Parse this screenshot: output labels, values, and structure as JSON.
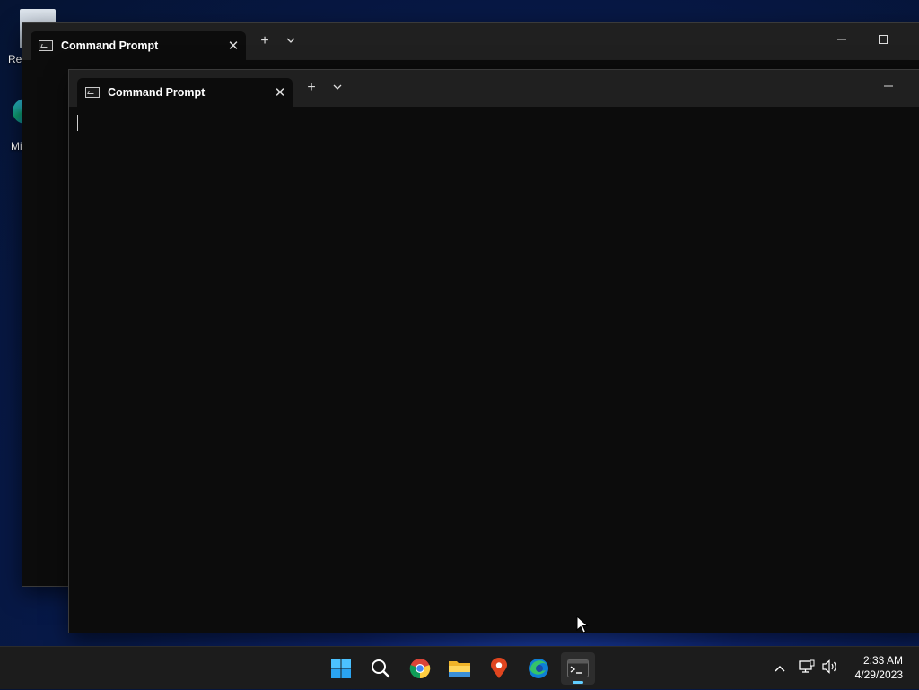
{
  "desktop": {
    "icons": [
      {
        "label": "Rec",
        "icon": "recycle-bin-icon"
      },
      {
        "label": "Mi",
        "icon": "edge-shortcut-icon"
      }
    ]
  },
  "windows": [
    {
      "app": "Windows Terminal",
      "tab_title": "Command Prompt",
      "tab_icon": "cmd-icon",
      "new_tab": "+",
      "close": "✕"
    },
    {
      "app": "Windows Terminal",
      "tab_title": "Command Prompt",
      "tab_icon": "cmd-icon",
      "new_tab": "+",
      "close": "✕"
    }
  ],
  "taskbar": {
    "apps": [
      "start-icon",
      "search-icon",
      "chrome-icon",
      "file-explorer-icon",
      "maps-icon",
      "edge-icon",
      "terminal-icon"
    ],
    "active_app": "terminal-icon",
    "clock": {
      "time": "2:33 AM",
      "date": "4/29/2023"
    }
  },
  "colors": {
    "terminal_bg": "#0c0c0c",
    "titlebar_bg": "#202020",
    "taskbar_bg": "#1c1c1c",
    "accent": "#60cdff"
  }
}
